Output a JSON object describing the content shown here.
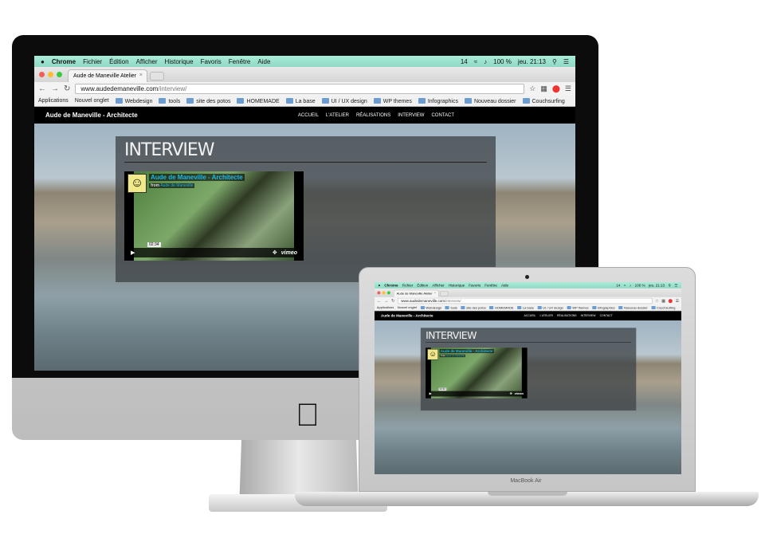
{
  "menubar": {
    "apple": "",
    "app": "Chrome",
    "items": [
      "Fichier",
      "Édition",
      "Afficher",
      "Historique",
      "Favoris",
      "Fenêtre",
      "Aide"
    ],
    "status": [
      "14",
      "100 %",
      "jeu. 21:13"
    ]
  },
  "browser": {
    "tab_title": "Aude de Maneville Atelier",
    "url_domain": "www.audedemaneville.com",
    "url_path": "/interview/",
    "bookmarks": [
      "Applications",
      "Nouvel onglet",
      "Webdesign",
      "tools",
      "site des potos",
      "HOMEMADE",
      "La base",
      "UI / UX design",
      "WP themes",
      "Infographics",
      "Nouveau dossier",
      "Couchsurfing"
    ]
  },
  "site": {
    "title": "Aude de Maneville - Architecte",
    "nav": [
      "ACCUEIL",
      "L'ATELIER",
      "RÉALISATIONS",
      "INTERVIEW",
      "CONTACT"
    ],
    "heading": "INTERVIEW",
    "video": {
      "title": "Aude de Maneville - Architecte",
      "from": "from",
      "author": "Aude de Maneville",
      "time": "02:34",
      "brand": "vimeo"
    }
  },
  "laptop": {
    "label": "MacBook Air"
  },
  "colors": {
    "menubar": "#a9ecd9",
    "accent": "#1ab7ea"
  }
}
